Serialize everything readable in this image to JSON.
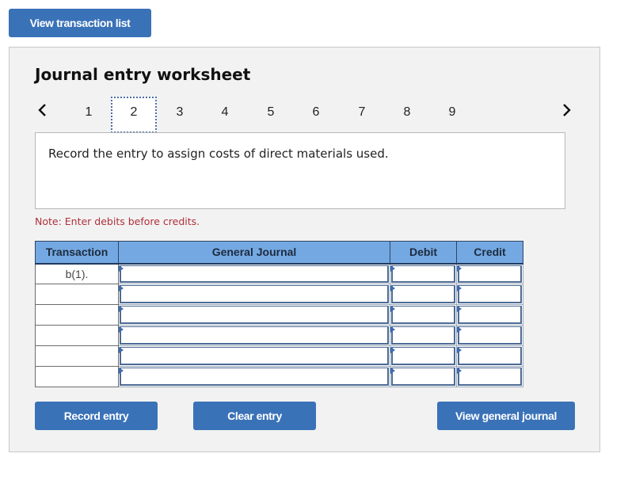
{
  "top_button": {
    "label": "View transaction list"
  },
  "worksheet": {
    "title": "Journal entry worksheet",
    "pagination": {
      "prev_icon": "chevron-left-icon",
      "next_icon": "chevron-right-icon",
      "pages": [
        "1",
        "2",
        "3",
        "4",
        "5",
        "6",
        "7",
        "8",
        "9"
      ],
      "active_page": "2"
    },
    "prompt": "Record the entry to assign costs of direct materials used.",
    "note": "Note: Enter debits before credits.",
    "table": {
      "headers": [
        "Transaction",
        "General Journal",
        "Debit",
        "Credit"
      ],
      "rows": [
        {
          "transaction": "b(1).",
          "account": "",
          "debit": "",
          "credit": ""
        },
        {
          "transaction": "",
          "account": "",
          "debit": "",
          "credit": ""
        },
        {
          "transaction": "",
          "account": "",
          "debit": "",
          "credit": ""
        },
        {
          "transaction": "",
          "account": "",
          "debit": "",
          "credit": ""
        },
        {
          "transaction": "",
          "account": "",
          "debit": "",
          "credit": ""
        },
        {
          "transaction": "",
          "account": "",
          "debit": "",
          "credit": ""
        }
      ]
    },
    "buttons": {
      "record": "Record entry",
      "clear": "Clear entry",
      "view_general_journal": "View general journal"
    }
  },
  "colors": {
    "button_blue": "#3a72b8",
    "header_blue": "#74a8e2",
    "note_red": "#b0303a",
    "panel_bg": "#f2f2f2"
  }
}
